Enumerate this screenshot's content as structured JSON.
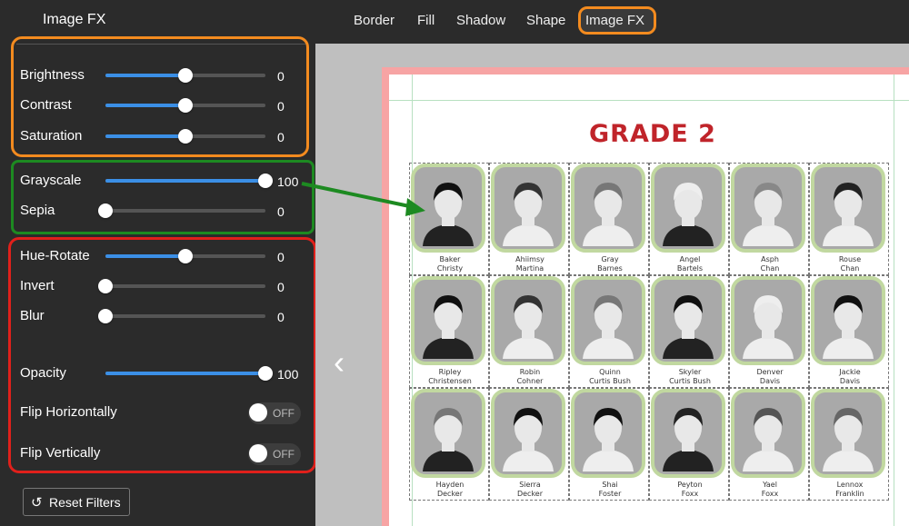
{
  "panel": {
    "title": "Image FX"
  },
  "sliders": [
    {
      "label": "Brightness",
      "value": "0",
      "position": 0.5
    },
    {
      "label": "Contrast",
      "value": "0",
      "position": 0.5
    },
    {
      "label": "Saturation",
      "value": "0",
      "position": 0.5
    },
    {
      "label": "Grayscale",
      "value": "100",
      "position": 1.0
    },
    {
      "label": "Sepia",
      "value": "0",
      "position": 0.0
    },
    {
      "label": "Hue-Rotate",
      "value": "0",
      "position": 0.5
    },
    {
      "label": "Invert",
      "value": "0",
      "position": 0.0
    },
    {
      "label": "Blur",
      "value": "0",
      "position": 0.0
    },
    {
      "label": "Opacity",
      "value": "100",
      "position": 1.0
    }
  ],
  "toggles": [
    {
      "label": "Flip Horizontally",
      "state": "OFF"
    },
    {
      "label": "Flip Vertically",
      "state": "OFF"
    }
  ],
  "reset": {
    "label": "Reset Filters"
  },
  "tabs": [
    "Border",
    "Fill",
    "Shadow",
    "Shape",
    "Image FX"
  ],
  "colors": {
    "highlight_orange": "#f38b1f",
    "highlight_green": "#1d8a21",
    "highlight_red": "#e0201b",
    "slider_blue": "#3b8fe6",
    "grade_red": "#c0242a"
  },
  "canvas": {
    "title": "GRADE 2",
    "students": [
      {
        "first": "Baker",
        "last": "Christy"
      },
      {
        "first": "Ahiimsy",
        "last": "Martina"
      },
      {
        "first": "Gray",
        "last": "Barnes"
      },
      {
        "first": "Angel",
        "last": "Bartels"
      },
      {
        "first": "Asph",
        "last": "Chan"
      },
      {
        "first": "Rouse",
        "last": "Chan"
      },
      {
        "first": "Ripley",
        "last": "Christensen"
      },
      {
        "first": "Robin",
        "last": "Cohner"
      },
      {
        "first": "Quinn",
        "last": "Curtis Bush"
      },
      {
        "first": "Skyler",
        "last": "Curtis Bush"
      },
      {
        "first": "Denver",
        "last": "Davis"
      },
      {
        "first": "Jackie",
        "last": "Davis"
      },
      {
        "first": "Hayden",
        "last": "Decker"
      },
      {
        "first": "Sierra",
        "last": "Decker"
      },
      {
        "first": "Shai",
        "last": "Foster"
      },
      {
        "first": "Peyton",
        "last": "Foxx"
      },
      {
        "first": "Yael",
        "last": "Foxx"
      },
      {
        "first": "Lennox",
        "last": "Franklin"
      }
    ]
  }
}
